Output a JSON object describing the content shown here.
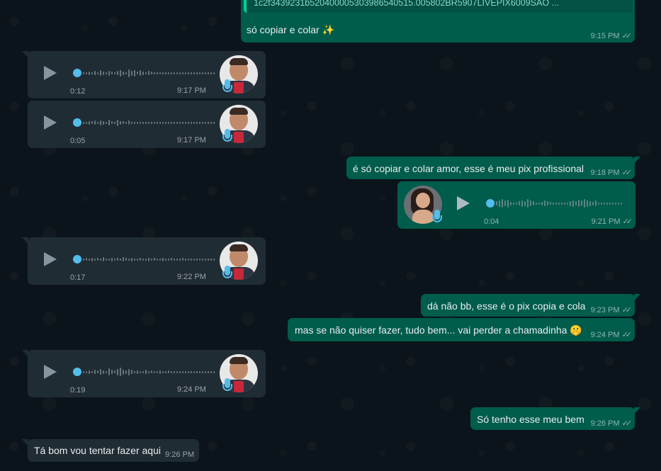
{
  "messages": [
    {
      "id": "m1",
      "direction": "out",
      "quote_text": "1c2f3439231b52040000530398654051​5.005802BR5907LIVEPIX6009SAO ...",
      "text": "só copiar e colar ✨",
      "time": "9:15 PM",
      "status": "read"
    },
    {
      "id": "a1",
      "direction": "in",
      "type": "audio",
      "duration": "0:12",
      "time": "9:17 PM"
    },
    {
      "id": "a2",
      "direction": "in",
      "type": "audio",
      "duration": "0:05",
      "time": "9:17 PM"
    },
    {
      "id": "m2",
      "direction": "out",
      "text": "é só copiar e colar amor, esse é meu pix profissional",
      "time": "9:18 PM",
      "status": "read"
    },
    {
      "id": "a3",
      "direction": "out",
      "type": "audio",
      "duration": "0:04",
      "time": "9:21 PM",
      "status": "read"
    },
    {
      "id": "a4",
      "direction": "in",
      "type": "audio",
      "duration": "0:17",
      "time": "9:22 PM"
    },
    {
      "id": "m3",
      "direction": "out",
      "text": "dá não bb, esse é o pix copia e cola",
      "time": "9:23 PM",
      "status": "read"
    },
    {
      "id": "m4",
      "direction": "out",
      "text": "mas se não quiser fazer, tudo bem... vai perder a chamadinha 🤫",
      "time": "9:24 PM",
      "status": "read"
    },
    {
      "id": "a5",
      "direction": "in",
      "type": "audio",
      "duration": "0:19",
      "time": "9:24 PM"
    },
    {
      "id": "m5",
      "direction": "out",
      "text": "Só tenho esse meu bem",
      "time": "9:26 PM",
      "status": "read"
    },
    {
      "id": "m6",
      "direction": "in",
      "text": "Tá bom vou tentar fazer aqui",
      "time": "9:26 PM"
    }
  ],
  "icons": {
    "play": "play-icon",
    "ticks": "double-check-icon",
    "mic": "microphone-icon"
  },
  "colors": {
    "outgoing_bubble": "#005c4b",
    "incoming_bubble": "#202c33",
    "background": "#0b141a",
    "accent_blue": "#53bdeb"
  }
}
